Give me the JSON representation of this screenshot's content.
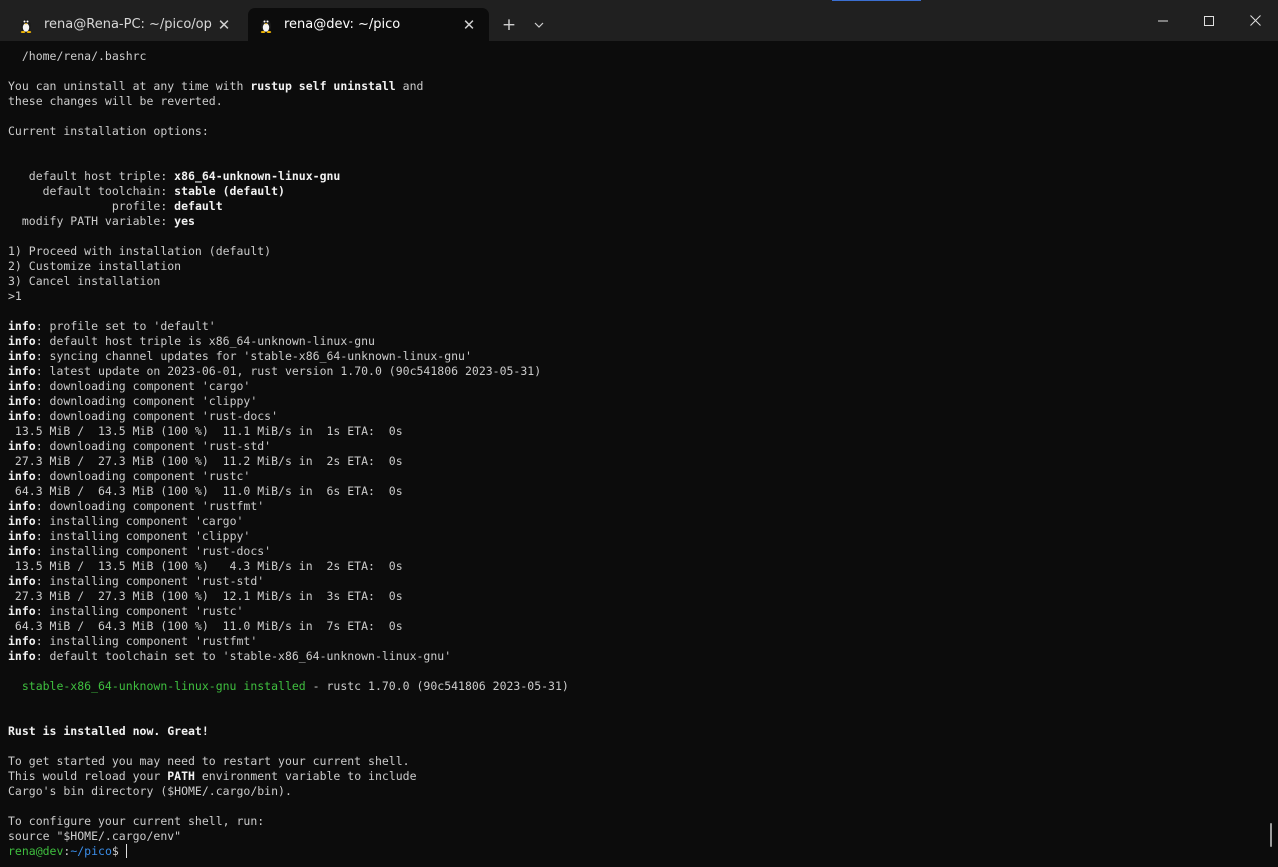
{
  "tabs": [
    {
      "label": "rena@Rena-PC: ~/pico/openo",
      "icon": "tux-icon",
      "close": "✕"
    },
    {
      "label": "rena@dev: ~/pico",
      "icon": "tux-icon",
      "close": "✕"
    }
  ],
  "toolbar": {
    "new_tab": "+",
    "dropdown": "⌄"
  },
  "window_controls": {
    "minimize": "minimize-icon",
    "maximize": "maximize-icon",
    "close": "close-icon"
  },
  "terminal": {
    "lines": [
      [
        {
          "t": "  /home/rena/.bashrc"
        }
      ],
      [],
      [
        {
          "t": "You can uninstall at any time with "
        },
        {
          "t": "rustup self uninstall",
          "s": "b"
        },
        {
          "t": " and"
        }
      ],
      [
        {
          "t": "these changes will be reverted."
        }
      ],
      [],
      [
        {
          "t": "Current installation options:"
        }
      ],
      [],
      [],
      [
        {
          "t": "   default host triple: "
        },
        {
          "t": "x86_64-unknown-linux-gnu",
          "s": "b"
        }
      ],
      [
        {
          "t": "     default toolchain: "
        },
        {
          "t": "stable (default)",
          "s": "b"
        }
      ],
      [
        {
          "t": "               profile: "
        },
        {
          "t": "default",
          "s": "b"
        }
      ],
      [
        {
          "t": "  modify PATH variable: "
        },
        {
          "t": "yes",
          "s": "b"
        }
      ],
      [],
      [
        {
          "t": "1) Proceed with installation (default)"
        }
      ],
      [
        {
          "t": "2) Customize installation"
        }
      ],
      [
        {
          "t": "3) Cancel installation"
        }
      ],
      [
        {
          "t": ">1"
        }
      ],
      [],
      [
        {
          "t": "info",
          "s": "b"
        },
        {
          "t": ": profile set to 'default'"
        }
      ],
      [
        {
          "t": "info",
          "s": "b"
        },
        {
          "t": ": default host triple is x86_64-unknown-linux-gnu"
        }
      ],
      [
        {
          "t": "info",
          "s": "b"
        },
        {
          "t": ": syncing channel updates for 'stable-x86_64-unknown-linux-gnu'"
        }
      ],
      [
        {
          "t": "info",
          "s": "b"
        },
        {
          "t": ": latest update on 2023-06-01, rust version 1.70.0 (90c541806 2023-05-31)"
        }
      ],
      [
        {
          "t": "info",
          "s": "b"
        },
        {
          "t": ": downloading component 'cargo'"
        }
      ],
      [
        {
          "t": "info",
          "s": "b"
        },
        {
          "t": ": downloading component 'clippy'"
        }
      ],
      [
        {
          "t": "info",
          "s": "b"
        },
        {
          "t": ": downloading component 'rust-docs'"
        }
      ],
      [
        {
          "t": " 13.5 MiB /  13.5 MiB (100 %)  11.1 MiB/s in  1s ETA:  0s"
        }
      ],
      [
        {
          "t": "info",
          "s": "b"
        },
        {
          "t": ": downloading component 'rust-std'"
        }
      ],
      [
        {
          "t": " 27.3 MiB /  27.3 MiB (100 %)  11.2 MiB/s in  2s ETA:  0s"
        }
      ],
      [
        {
          "t": "info",
          "s": "b"
        },
        {
          "t": ": downloading component 'rustc'"
        }
      ],
      [
        {
          "t": " 64.3 MiB /  64.3 MiB (100 %)  11.0 MiB/s in  6s ETA:  0s"
        }
      ],
      [
        {
          "t": "info",
          "s": "b"
        },
        {
          "t": ": downloading component 'rustfmt'"
        }
      ],
      [
        {
          "t": "info",
          "s": "b"
        },
        {
          "t": ": installing component 'cargo'"
        }
      ],
      [
        {
          "t": "info",
          "s": "b"
        },
        {
          "t": ": installing component 'clippy'"
        }
      ],
      [
        {
          "t": "info",
          "s": "b"
        },
        {
          "t": ": installing component 'rust-docs'"
        }
      ],
      [
        {
          "t": " 13.5 MiB /  13.5 MiB (100 %)   4.3 MiB/s in  2s ETA:  0s"
        }
      ],
      [
        {
          "t": "info",
          "s": "b"
        },
        {
          "t": ": installing component 'rust-std'"
        }
      ],
      [
        {
          "t": " 27.3 MiB /  27.3 MiB (100 %)  12.1 MiB/s in  3s ETA:  0s"
        }
      ],
      [
        {
          "t": "info",
          "s": "b"
        },
        {
          "t": ": installing component 'rustc'"
        }
      ],
      [
        {
          "t": " 64.3 MiB /  64.3 MiB (100 %)  11.0 MiB/s in  7s ETA:  0s"
        }
      ],
      [
        {
          "t": "info",
          "s": "b"
        },
        {
          "t": ": installing component 'rustfmt'"
        }
      ],
      [
        {
          "t": "info",
          "s": "b"
        },
        {
          "t": ": default toolchain set to 'stable-x86_64-unknown-linux-gnu'"
        }
      ],
      [],
      [
        {
          "t": "  stable-x86_64-unknown-linux-gnu installed",
          "s": "g"
        },
        {
          "t": " - rustc 1.70.0 (90c541806 2023-05-31)"
        }
      ],
      [],
      [],
      [
        {
          "t": "Rust is installed now. Great!",
          "s": "b"
        }
      ],
      [],
      [
        {
          "t": "To get started you may need to restart your current shell."
        }
      ],
      [
        {
          "t": "This would reload your "
        },
        {
          "t": "PATH",
          "s": "b"
        },
        {
          "t": " environment variable to include"
        }
      ],
      [
        {
          "t": "Cargo's bin directory ($HOME/.cargo/bin)."
        }
      ],
      [],
      [
        {
          "t": "To configure your current shell, run:"
        }
      ],
      [
        {
          "t": "source \"$HOME/.cargo/env\""
        }
      ]
    ],
    "prompt": {
      "user": "rena@dev",
      "sep": ":",
      "path": "~/pico",
      "symbol": "$ "
    }
  }
}
